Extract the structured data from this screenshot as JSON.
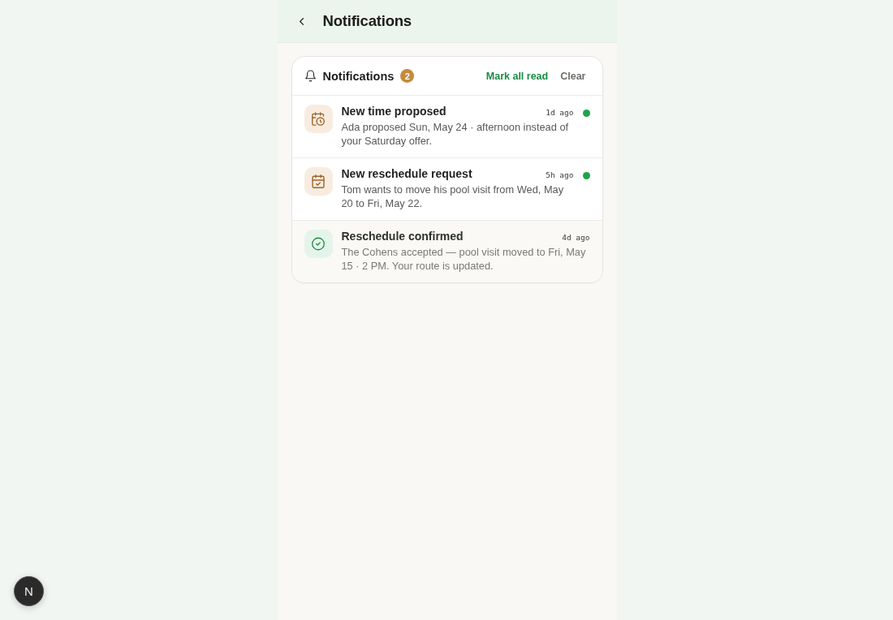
{
  "header": {
    "title": "Notifications"
  },
  "panel": {
    "title": "Notifications",
    "count": "2",
    "actions": [
      {
        "label": "Mark all read",
        "kind": "primary"
      },
      {
        "label": "Clear",
        "kind": "secondary"
      }
    ]
  },
  "notifications": [
    {
      "kind": "proposal",
      "title": "New time proposed",
      "time": "1d ago",
      "body": "Ada proposed Sun, May 24 · afternoon instead of your Saturday offer.",
      "unread": true
    },
    {
      "kind": "request",
      "title": "New reschedule request",
      "time": "5h ago",
      "body": "Tom wants to move his pool visit from Wed, May 20 to Fri, May 22.",
      "unread": true
    },
    {
      "kind": "confirmed",
      "title": "Reschedule confirmed",
      "time": "4d ago",
      "body": "The Cohens accepted — pool visit moved to Fri, May 15 · 2 PM. Your route is updated.",
      "unread": false
    }
  ],
  "dev_badge": {
    "label": "N"
  }
}
